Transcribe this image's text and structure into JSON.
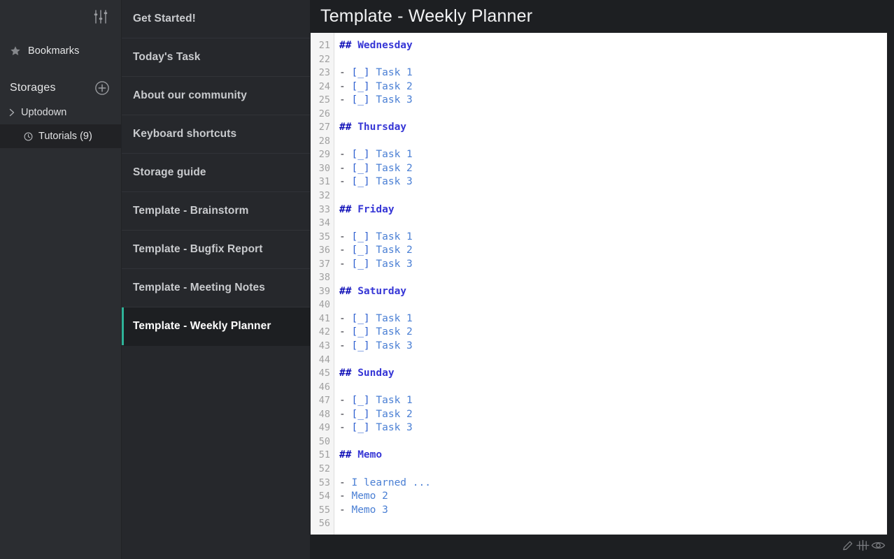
{
  "app": {
    "accent_color": "#2eb398",
    "sidebar_bg": "#2b2d31",
    "notelist_bg": "#26282c",
    "main_bg": "#1d1f22",
    "editor_bg": "#ffffff",
    "gutter_bg": "#f5f5f5"
  },
  "sidebar": {
    "settings_icon": "sliders-icon",
    "bookmarks": {
      "icon": "star-icon",
      "label": "Bookmarks"
    },
    "storages": {
      "label": "Storages",
      "add_icon": "plus-circle-icon"
    },
    "tree": [
      {
        "icon": "chevron-right-icon",
        "label": "Uptodown",
        "type": "storage",
        "selected": false
      },
      {
        "icon": "clock-icon",
        "label": "Tutorials (9)",
        "type": "folder",
        "selected": true
      }
    ]
  },
  "notelist": {
    "items": [
      {
        "label": "Get Started!",
        "selected": false
      },
      {
        "label": "Today's Task",
        "selected": false
      },
      {
        "label": "About our community",
        "selected": false
      },
      {
        "label": "Keyboard shortcuts",
        "selected": false
      },
      {
        "label": "Storage guide",
        "selected": false
      },
      {
        "label": "Template - Brainstorm",
        "selected": false
      },
      {
        "label": "Template - Bugfix Report",
        "selected": false
      },
      {
        "label": "Template - Meeting Notes",
        "selected": false
      },
      {
        "label": "Template - Weekly Planner",
        "selected": true
      }
    ]
  },
  "editor": {
    "title": "Template - Weekly Planner",
    "first_line_number": 21,
    "lines": [
      {
        "n": 21,
        "tokens": [
          {
            "t": "## ",
            "c": "tok-hash"
          },
          {
            "t": "Wednesday",
            "c": "tok-head"
          }
        ]
      },
      {
        "n": 22,
        "tokens": []
      },
      {
        "n": 23,
        "tokens": [
          {
            "t": "- ",
            "c": "tok-bullet"
          },
          {
            "t": "[_] ",
            "c": "tok-box"
          },
          {
            "t": "Task 1",
            "c": "tok-text"
          }
        ]
      },
      {
        "n": 24,
        "tokens": [
          {
            "t": "- ",
            "c": "tok-bullet"
          },
          {
            "t": "[_] ",
            "c": "tok-box"
          },
          {
            "t": "Task 2",
            "c": "tok-text"
          }
        ]
      },
      {
        "n": 25,
        "tokens": [
          {
            "t": "- ",
            "c": "tok-bullet"
          },
          {
            "t": "[_] ",
            "c": "tok-box"
          },
          {
            "t": "Task 3",
            "c": "tok-text"
          }
        ]
      },
      {
        "n": 26,
        "tokens": []
      },
      {
        "n": 27,
        "tokens": [
          {
            "t": "## ",
            "c": "tok-hash"
          },
          {
            "t": "Thursday",
            "c": "tok-head"
          }
        ]
      },
      {
        "n": 28,
        "tokens": []
      },
      {
        "n": 29,
        "tokens": [
          {
            "t": "- ",
            "c": "tok-bullet"
          },
          {
            "t": "[_] ",
            "c": "tok-box"
          },
          {
            "t": "Task 1",
            "c": "tok-text"
          }
        ]
      },
      {
        "n": 30,
        "tokens": [
          {
            "t": "- ",
            "c": "tok-bullet"
          },
          {
            "t": "[_] ",
            "c": "tok-box"
          },
          {
            "t": "Task 2",
            "c": "tok-text"
          }
        ]
      },
      {
        "n": 31,
        "tokens": [
          {
            "t": "- ",
            "c": "tok-bullet"
          },
          {
            "t": "[_] ",
            "c": "tok-box"
          },
          {
            "t": "Task 3",
            "c": "tok-text"
          }
        ]
      },
      {
        "n": 32,
        "tokens": []
      },
      {
        "n": 33,
        "tokens": [
          {
            "t": "## ",
            "c": "tok-hash"
          },
          {
            "t": "Friday",
            "c": "tok-head"
          }
        ]
      },
      {
        "n": 34,
        "tokens": []
      },
      {
        "n": 35,
        "tokens": [
          {
            "t": "- ",
            "c": "tok-bullet"
          },
          {
            "t": "[_] ",
            "c": "tok-box"
          },
          {
            "t": "Task 1",
            "c": "tok-text"
          }
        ]
      },
      {
        "n": 36,
        "tokens": [
          {
            "t": "- ",
            "c": "tok-bullet"
          },
          {
            "t": "[_] ",
            "c": "tok-box"
          },
          {
            "t": "Task 2",
            "c": "tok-text"
          }
        ]
      },
      {
        "n": 37,
        "tokens": [
          {
            "t": "- ",
            "c": "tok-bullet"
          },
          {
            "t": "[_] ",
            "c": "tok-box"
          },
          {
            "t": "Task 3",
            "c": "tok-text"
          }
        ]
      },
      {
        "n": 38,
        "tokens": []
      },
      {
        "n": 39,
        "tokens": [
          {
            "t": "## ",
            "c": "tok-hash"
          },
          {
            "t": "Saturday",
            "c": "tok-head"
          }
        ]
      },
      {
        "n": 40,
        "tokens": []
      },
      {
        "n": 41,
        "tokens": [
          {
            "t": "- ",
            "c": "tok-bullet"
          },
          {
            "t": "[_] ",
            "c": "tok-box"
          },
          {
            "t": "Task 1",
            "c": "tok-text"
          }
        ]
      },
      {
        "n": 42,
        "tokens": [
          {
            "t": "- ",
            "c": "tok-bullet"
          },
          {
            "t": "[_] ",
            "c": "tok-box"
          },
          {
            "t": "Task 2",
            "c": "tok-text"
          }
        ]
      },
      {
        "n": 43,
        "tokens": [
          {
            "t": "- ",
            "c": "tok-bullet"
          },
          {
            "t": "[_] ",
            "c": "tok-box"
          },
          {
            "t": "Task 3",
            "c": "tok-text"
          }
        ]
      },
      {
        "n": 44,
        "tokens": []
      },
      {
        "n": 45,
        "tokens": [
          {
            "t": "## ",
            "c": "tok-hash"
          },
          {
            "t": "Sunday",
            "c": "tok-head"
          }
        ]
      },
      {
        "n": 46,
        "tokens": []
      },
      {
        "n": 47,
        "tokens": [
          {
            "t": "- ",
            "c": "tok-bullet"
          },
          {
            "t": "[_] ",
            "c": "tok-box"
          },
          {
            "t": "Task 1",
            "c": "tok-text"
          }
        ]
      },
      {
        "n": 48,
        "tokens": [
          {
            "t": "- ",
            "c": "tok-bullet"
          },
          {
            "t": "[_] ",
            "c": "tok-box"
          },
          {
            "t": "Task 2",
            "c": "tok-text"
          }
        ]
      },
      {
        "n": 49,
        "tokens": [
          {
            "t": "- ",
            "c": "tok-bullet"
          },
          {
            "t": "[_] ",
            "c": "tok-box"
          },
          {
            "t": "Task 3",
            "c": "tok-text"
          }
        ]
      },
      {
        "n": 50,
        "tokens": []
      },
      {
        "n": 51,
        "tokens": [
          {
            "t": "## ",
            "c": "tok-hash"
          },
          {
            "t": "Memo",
            "c": "tok-head"
          }
        ]
      },
      {
        "n": 52,
        "tokens": []
      },
      {
        "n": 53,
        "tokens": [
          {
            "t": "- ",
            "c": "tok-bullet"
          },
          {
            "t": "I learned ...",
            "c": "tok-plain"
          }
        ]
      },
      {
        "n": 54,
        "tokens": [
          {
            "t": "- ",
            "c": "tok-bullet"
          },
          {
            "t": "Memo 2",
            "c": "tok-plain"
          }
        ]
      },
      {
        "n": 55,
        "tokens": [
          {
            "t": "- ",
            "c": "tok-bullet"
          },
          {
            "t": "Memo 3",
            "c": "tok-plain"
          }
        ]
      },
      {
        "n": 56,
        "tokens": []
      }
    ]
  },
  "statusbar": {
    "modes": [
      {
        "icon": "pencil-icon",
        "name": "edit-mode"
      },
      {
        "icon": "split-view-icon",
        "name": "split-mode"
      },
      {
        "icon": "eye-icon",
        "name": "preview-mode"
      }
    ]
  }
}
